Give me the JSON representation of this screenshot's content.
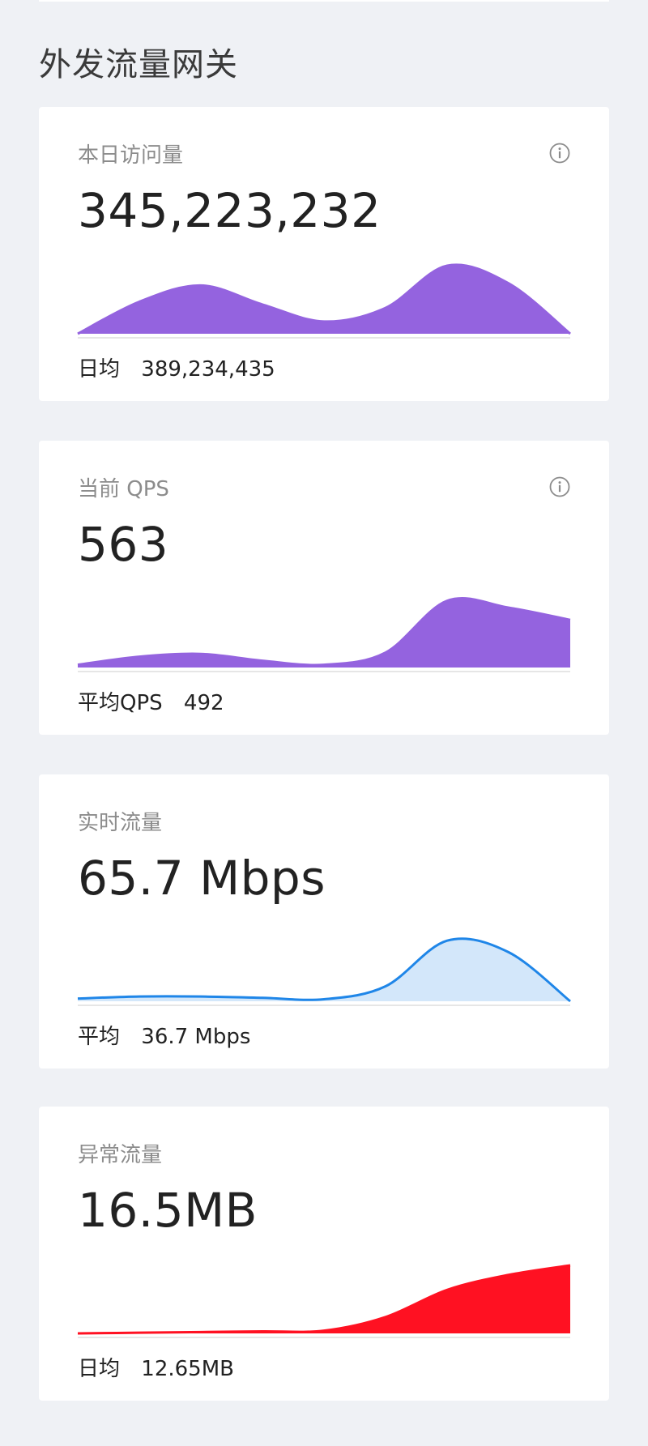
{
  "section": {
    "title": "外发流量网关"
  },
  "cards": [
    {
      "label": "本日访问量",
      "value": "345,223,232",
      "footer_label": "日均",
      "footer_value": "389,234,435",
      "has_info_icon": true,
      "icon": "info-icon",
      "chart_data": {
        "type": "area",
        "color": "#9463df",
        "fill": "#9463df",
        "values": [
          0,
          0.47,
          0.71,
          0.43,
          0.18,
          0.38,
          1.0,
          0.74,
          0
        ]
      }
    },
    {
      "label": "当前 QPS",
      "value": "563",
      "footer_label": "平均QPS",
      "footer_value": "492",
      "has_info_icon": true,
      "icon": "info-icon",
      "chart_data": {
        "type": "area",
        "color": "#9463df",
        "fill": "#9463df",
        "values": [
          0.04,
          0.16,
          0.2,
          0.1,
          0.04,
          0.22,
          0.98,
          0.88,
          0.7
        ]
      }
    },
    {
      "label": "实时流量",
      "value": "65.7 Mbps",
      "footer_label": "平均",
      "footer_value": "36.7 Mbps",
      "has_info_icon": false,
      "chart_data": {
        "type": "area",
        "color": "#1f86e8",
        "fill": "#d3e7fa",
        "values": [
          0.04,
          0.07,
          0.07,
          0.05,
          0.03,
          0.22,
          0.89,
          0.72,
          0
        ]
      }
    },
    {
      "label": "异常流量",
      "value": "16.5MB",
      "footer_label": "日均",
      "footer_value": "12.65MB",
      "has_info_icon": false,
      "chart_data": {
        "type": "area",
        "color": "#ff1122",
        "fill": "#ff1122",
        "values": [
          0,
          0.01,
          0.02,
          0.03,
          0.04,
          0.24,
          0.64,
          0.86,
          1.0
        ]
      }
    }
  ]
}
